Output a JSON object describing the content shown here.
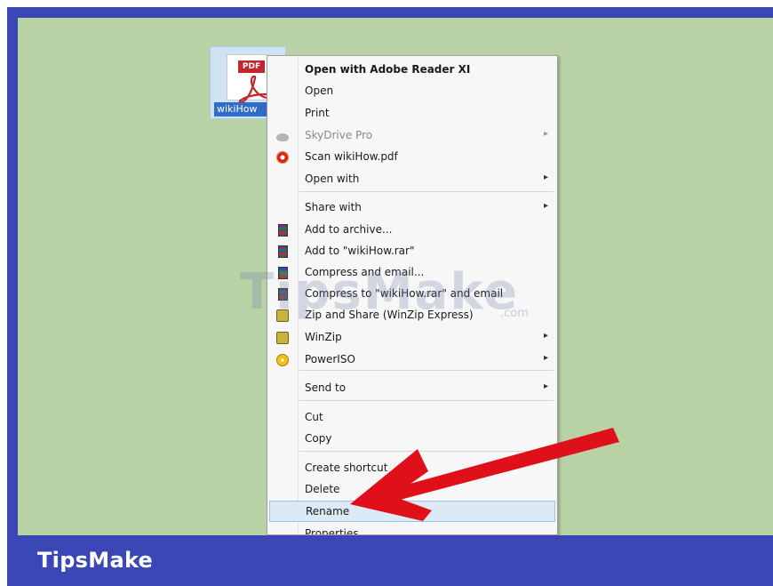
{
  "file": {
    "name": "wikiHow",
    "badge": "PDF",
    "icon": "pdf-file-icon"
  },
  "context_menu": {
    "items": [
      {
        "label": "Open with Adobe Reader XI",
        "bold": true
      },
      {
        "label": "Open"
      },
      {
        "label": "Print"
      },
      {
        "label": "SkyDrive Pro",
        "disabled": true,
        "submenu": true,
        "icon": "cloud-icon"
      },
      {
        "label": "Scan wikiHow.pdf",
        "icon": "scan-icon"
      },
      {
        "label": "Open with",
        "submenu": true
      },
      {
        "label": "Share with",
        "submenu": true
      },
      {
        "label": "Add to archive...",
        "icon": "rar-icon"
      },
      {
        "label": "Add to \"wikiHow.rar\"",
        "icon": "rar-icon"
      },
      {
        "label": "Compress and email...",
        "icon": "rar-icon"
      },
      {
        "label": "Compress to \"wikiHow.rar\" and email",
        "icon": "rar-icon"
      },
      {
        "label": "Zip and Share (WinZip Express)",
        "icon": "winzip-icon"
      },
      {
        "label": "WinZip",
        "submenu": true,
        "icon": "winzip-icon"
      },
      {
        "label": "PowerISO",
        "submenu": true,
        "icon": "poweriso-icon"
      },
      {
        "label": "Send to",
        "submenu": true
      },
      {
        "label": "Cut"
      },
      {
        "label": "Copy"
      },
      {
        "label": "Create shortcut"
      },
      {
        "label": "Delete"
      },
      {
        "label": "Rename",
        "highlighted": true
      },
      {
        "label": "Properties"
      }
    ],
    "submenu_glyph": "▸"
  },
  "watermark": {
    "text": "TipsMake",
    "suffix": ".com"
  },
  "footer": {
    "brand": "TipsMake"
  },
  "colors": {
    "frame_blue": "#3a47b5",
    "desktop_green": "#b8d2a6",
    "arrow_red": "#e0101a",
    "highlight": "#dceaf6"
  }
}
